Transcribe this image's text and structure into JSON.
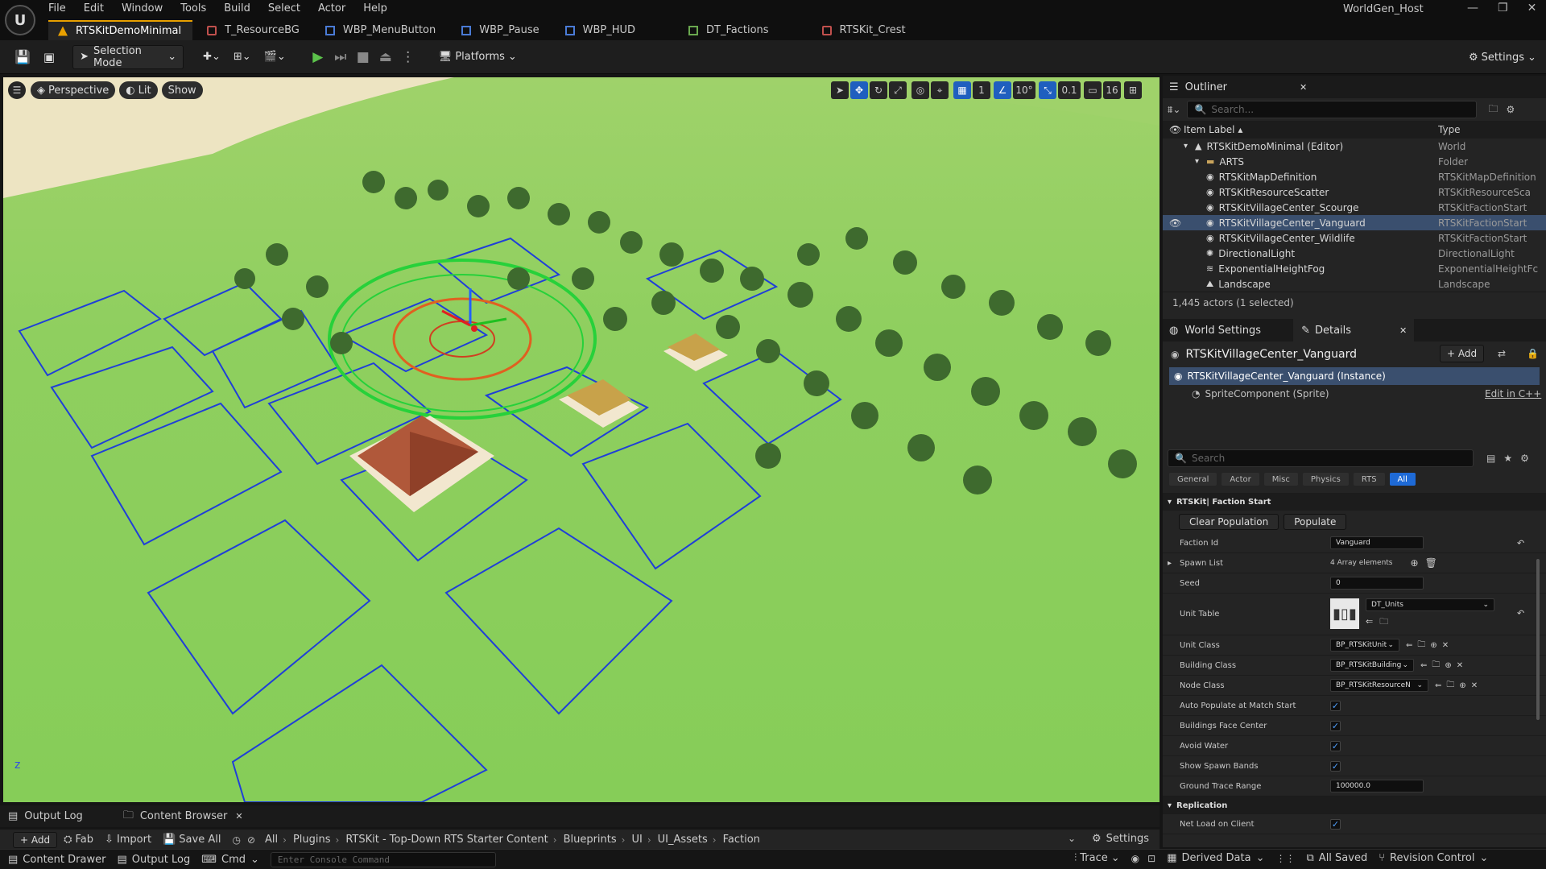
{
  "menu": [
    "File",
    "Edit",
    "Window",
    "Tools",
    "Build",
    "Select",
    "Actor",
    "Help"
  ],
  "tabs": [
    {
      "label": "RTSKitDemoMinimal",
      "icon": "level-icon",
      "color": "#e8a000"
    },
    {
      "label": "T_ResourceBG",
      "icon": "texture-icon",
      "color": "#c0504d"
    },
    {
      "label": "WBP_MenuButton",
      "icon": "widget-icon",
      "color": "#4a7bd6"
    },
    {
      "label": "WBP_Pause",
      "icon": "widget-icon",
      "color": "#4a7bd6"
    },
    {
      "label": "WBP_HUD",
      "icon": "widget-icon",
      "color": "#4a7bd6"
    },
    {
      "label": "DT_Factions",
      "icon": "datatable-icon",
      "color": "#6aa84f"
    },
    {
      "label": "RTSKit_Crest",
      "icon": "texture-icon",
      "color": "#c0504d"
    }
  ],
  "window_title": "WorldGen_Host",
  "toolbar": {
    "selection_mode": "Selection Mode",
    "platforms": "Platforms",
    "settings": "Settings"
  },
  "viewport": {
    "perspective": "Perspective",
    "lit": "Lit",
    "show": "Show",
    "grid_value": "1",
    "angle_value": "10°",
    "scale_value": "0.1",
    "camera_speed": "16",
    "axis_label": "z"
  },
  "outliner": {
    "title": "Outliner",
    "search_placeholder": "Search...",
    "col_label": "Item Label ▴",
    "col_type": "Type",
    "rows": [
      {
        "label": "RTSKitDemoMinimal (Editor)",
        "type": "World",
        "indent": 1,
        "icon": "world-icon"
      },
      {
        "label": "ARTS",
        "type": "Folder",
        "indent": 2,
        "icon": "folder-icon"
      },
      {
        "label": "RTSKitMapDefinition",
        "type": "RTSKitMapDefinition",
        "indent": 3,
        "icon": "actor-icon"
      },
      {
        "label": "RTSKitResourceScatter",
        "type": "RTSKitResourceSca",
        "indent": 3,
        "icon": "actor-icon"
      },
      {
        "label": "RTSKitVillageCenter_Scourge",
        "type": "RTSKitFactionStart",
        "indent": 3,
        "icon": "actor-icon"
      },
      {
        "label": "RTSKitVillageCenter_Vanguard",
        "type": "RTSKitFactionStart",
        "indent": 3,
        "icon": "actor-icon",
        "selected": true
      },
      {
        "label": "RTSKitVillageCenter_Wildlife",
        "type": "RTSKitFactionStart",
        "indent": 3,
        "icon": "actor-icon"
      },
      {
        "label": "DirectionalLight",
        "type": "DirectionalLight",
        "indent": 2,
        "icon": "light-icon"
      },
      {
        "label": "ExponentialHeightFog",
        "type": "ExponentialHeightFc",
        "indent": 2,
        "icon": "fog-icon"
      },
      {
        "label": "Landscape",
        "type": "Landscape",
        "indent": 2,
        "icon": "landscape-icon"
      }
    ],
    "footer": "1,445 actors (1 selected)"
  },
  "details": {
    "world_settings_tab": "World Settings",
    "details_tab": "Details",
    "actor_name": "RTSKitVillageCenter_Vanguard",
    "add_label": "+ Add",
    "instance_label": "RTSKitVillageCenter_Vanguard (Instance)",
    "component_label": "SpriteComponent (Sprite)",
    "edit_cpp": "Edit in C++",
    "search_placeholder": "Search",
    "filters": [
      "General",
      "Actor",
      "Misc",
      "Physics",
      "RTS",
      "All"
    ],
    "active_filter": "All",
    "category": "RTSKit| Faction Start",
    "clear_population": "Clear Population",
    "populate": "Populate",
    "faction_id_label": "Faction Id",
    "faction_id": "Vanguard",
    "spawn_list_label": "Spawn List",
    "spawn_list": "4 Array elements",
    "seed_label": "Seed",
    "seed": "0",
    "unit_table_label": "Unit Table",
    "unit_table": "DT_Units",
    "unit_class_label": "Unit Class",
    "unit_class": "BP_RTSKitUnit",
    "building_class_label": "Building Class",
    "building_class": "BP_RTSKitBuilding",
    "node_class_label": "Node Class",
    "node_class": "BP_RTSKitResourceN",
    "checks": [
      {
        "label": "Auto Populate at Match Start",
        "checked": true
      },
      {
        "label": "Buildings Face Center",
        "checked": true
      },
      {
        "label": "Avoid Water",
        "checked": true
      },
      {
        "label": "Show Spawn Bands",
        "checked": true
      }
    ],
    "ground_trace_label": "Ground Trace Range",
    "ground_trace": "100000.0",
    "replication_category": "Replication",
    "net_load_label": "Net Load on Client",
    "net_load": true
  },
  "bottom": {
    "output_log": "Output Log",
    "content_browser": "Content Browser",
    "add": "+ Add",
    "fab": "Fab",
    "import": "Import",
    "save_all": "Save All",
    "crumbs": [
      "All",
      "Plugins",
      "RTSKit - Top-Down RTS Starter Content",
      "Blueprints",
      "UI",
      "UI_Assets",
      "Faction"
    ],
    "settings": "Settings"
  },
  "status": {
    "content_drawer": "Content Drawer",
    "output_log": "Output Log",
    "cmd": "Cmd",
    "console_placeholder": "Enter Console Command",
    "trace": "Trace",
    "derived_data": "Derived Data",
    "all_saved": "All Saved",
    "revision_control": "Revision Control"
  },
  "colors": {
    "accent": "#e8a000",
    "selection": "#3a4f6e",
    "blue_filter": "#1e6ad6",
    "grass": "#8fcf5f",
    "grid_lines": "#1f3fd8"
  }
}
